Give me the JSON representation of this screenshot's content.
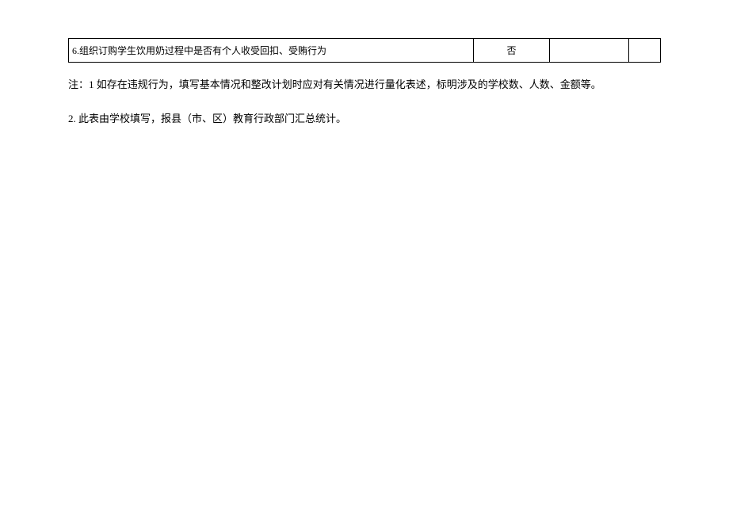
{
  "table": {
    "row": {
      "question": "6.组织订购学生饮用奶过程中是否有个人收受回扣、受贿行为",
      "answer": "否",
      "col3": "",
      "col4": ""
    }
  },
  "notes": {
    "line1": "注：1 如存在违规行为，填写基本情况和整改计划时应对有关情况进行量化表述，标明涉及的学校数、人数、金额等。",
    "line2": "2. 此表由学校填写，报县（市、区）教育行政部门汇总统计。"
  }
}
